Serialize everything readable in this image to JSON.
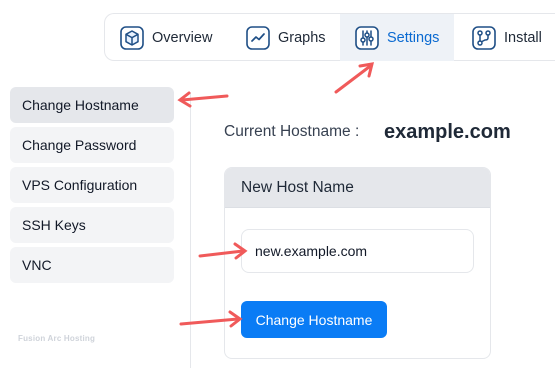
{
  "tabs": [
    {
      "label": "Overview",
      "icon": "cube-icon",
      "active": false
    },
    {
      "label": "Graphs",
      "icon": "graph-icon",
      "active": false
    },
    {
      "label": "Settings",
      "icon": "sliders-icon",
      "active": true
    },
    {
      "label": "Install",
      "icon": "install-icon",
      "active": false
    }
  ],
  "sidebar": {
    "items": [
      {
        "label": "Change Hostname",
        "active": true
      },
      {
        "label": "Change Password",
        "active": false
      },
      {
        "label": "VPS Configuration",
        "active": false
      },
      {
        "label": "SSH Keys",
        "active": false
      },
      {
        "label": "VNC",
        "active": false
      }
    ],
    "brand": "Fusion Arc Hosting"
  },
  "main": {
    "current_label": "Current Hostname :",
    "current_value": "example.com",
    "card": {
      "title": "New Host Name",
      "input_value": "new.example.com",
      "button_label": "Change Hostname"
    }
  },
  "colors": {
    "accent": "#0a7cf5",
    "active_tab_bg": "#eef2f7",
    "annotation_arrow": "#f05a5a"
  }
}
